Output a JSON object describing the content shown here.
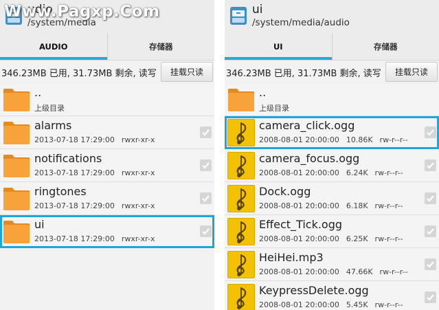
{
  "watermark": "Www.Pagxp.Com",
  "left": {
    "title": "udio",
    "path": "/system/media",
    "tabs": [
      {
        "label": "AUDIO",
        "active": true
      },
      {
        "label": "存储器",
        "active": false
      }
    ],
    "storage_info": "346.23MB 已用, 31.73MB 剩余, 读写",
    "mount_button": "挂载只读",
    "items": [
      {
        "name": "..",
        "date": "上级目录",
        "size": "",
        "perm": "",
        "type": "folder",
        "checkbox": false,
        "selected": false
      },
      {
        "name": "alarms",
        "date": "2013-07-18 17:29:00",
        "size": "",
        "perm": "rwxr-xr-x",
        "type": "folder",
        "checkbox": true,
        "selected": false
      },
      {
        "name": "notifications",
        "date": "2013-07-18 17:29:00",
        "size": "",
        "perm": "rwxr-xr-x",
        "type": "folder",
        "checkbox": true,
        "selected": false
      },
      {
        "name": "ringtones",
        "date": "2013-07-18 17:29:00",
        "size": "",
        "perm": "rwxr-xr-x",
        "type": "folder",
        "checkbox": true,
        "selected": false
      },
      {
        "name": "ui",
        "date": "2013-07-18 17:29:00",
        "size": "",
        "perm": "rwxr-xr-x",
        "type": "folder",
        "checkbox": true,
        "selected": true
      }
    ]
  },
  "right": {
    "title": "ui",
    "path": "/system/media/audio",
    "tabs": [
      {
        "label": "UI",
        "active": true
      },
      {
        "label": "存储器",
        "active": false
      }
    ],
    "storage_info": "346.23MB 已用, 31.73MB 剩余, 读写",
    "mount_button": "挂载只读",
    "items": [
      {
        "name": "..",
        "date": "上级目录",
        "size": "",
        "perm": "",
        "type": "folder",
        "checkbox": false,
        "selected": false
      },
      {
        "name": "camera_click.ogg",
        "date": "2008-08-01 20:00:00",
        "size": "10.86K",
        "perm": "rw-r--r--",
        "type": "audio",
        "checkbox": true,
        "selected": true
      },
      {
        "name": "camera_focus.ogg",
        "date": "2008-08-01 20:00:00",
        "size": "6.24K",
        "perm": "rw-r--r--",
        "type": "audio",
        "checkbox": true,
        "selected": false
      },
      {
        "name": "Dock.ogg",
        "date": "2008-08-01 20:00:00",
        "size": "6.18K",
        "perm": "rw-r--r--",
        "type": "audio",
        "checkbox": true,
        "selected": false
      },
      {
        "name": "Effect_Tick.ogg",
        "date": "2008-08-01 20:00:00",
        "size": "6.25K",
        "perm": "rw-r--r--",
        "type": "audio",
        "checkbox": true,
        "selected": false
      },
      {
        "name": "HeiHei.mp3",
        "date": "2008-08-01 20:00:00",
        "size": "47.66K",
        "perm": "rw-r--r--",
        "type": "audio",
        "checkbox": true,
        "selected": false
      },
      {
        "name": "KeypressDelete.ogg",
        "date": "2008-08-01 20:00:00",
        "size": "5.45K",
        "perm": "rw-r--r--",
        "type": "audio",
        "checkbox": true,
        "selected": false
      }
    ]
  },
  "colors": {
    "accent": "#29a8d8",
    "selection": "#1ea5dc",
    "folder": "#f7a23b",
    "audio_icon": "#f2c200"
  },
  "icons": {
    "app": "file-manager-icon",
    "folder": "folder-icon",
    "audio": "music-note-icon",
    "check": "checkmark-icon"
  }
}
